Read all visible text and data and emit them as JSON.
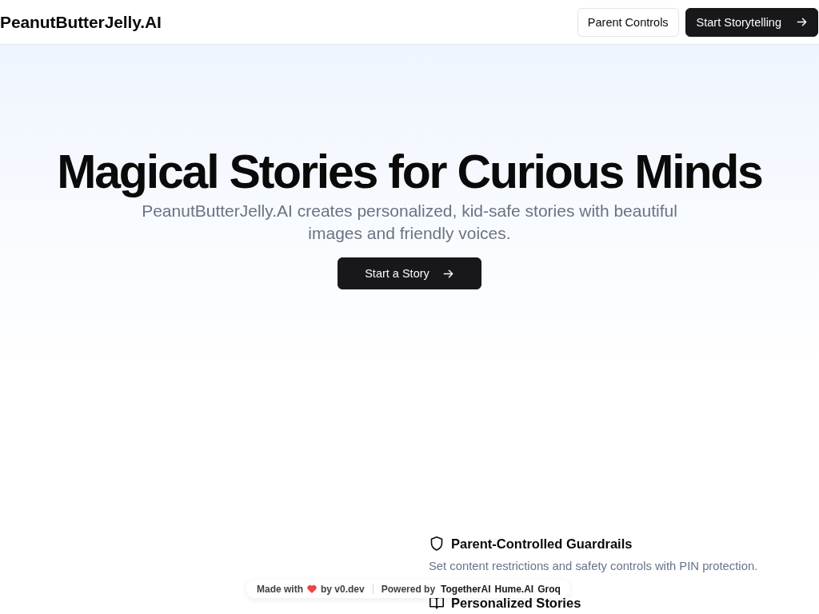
{
  "header": {
    "brand": "PeanutButterJelly.AI",
    "buttons": [
      {
        "label": "Parent Controls",
        "kind": "outline"
      },
      {
        "label": "Start Storytelling",
        "kind": "primary"
      }
    ]
  },
  "hero": {
    "title": "Magical Stories for Curious Minds",
    "subtitle": "PeanutButterJelly.AI creates personalized, kid-safe stories with beautiful images and friendly voices.",
    "button": {
      "label": "Start a Story"
    }
  },
  "features": [
    {
      "title": "Parent-Controlled Guardrails",
      "description": "Set content restrictions and safety controls with PIN protection."
    },
    {
      "title": "Personalized Stories"
    }
  ],
  "badge": {
    "made_with": "Made with",
    "by": "by v0.dev",
    "powered_by": "Powered by",
    "partners": [
      "TogetherAI",
      "Hume.AI",
      "Groq"
    ]
  }
}
